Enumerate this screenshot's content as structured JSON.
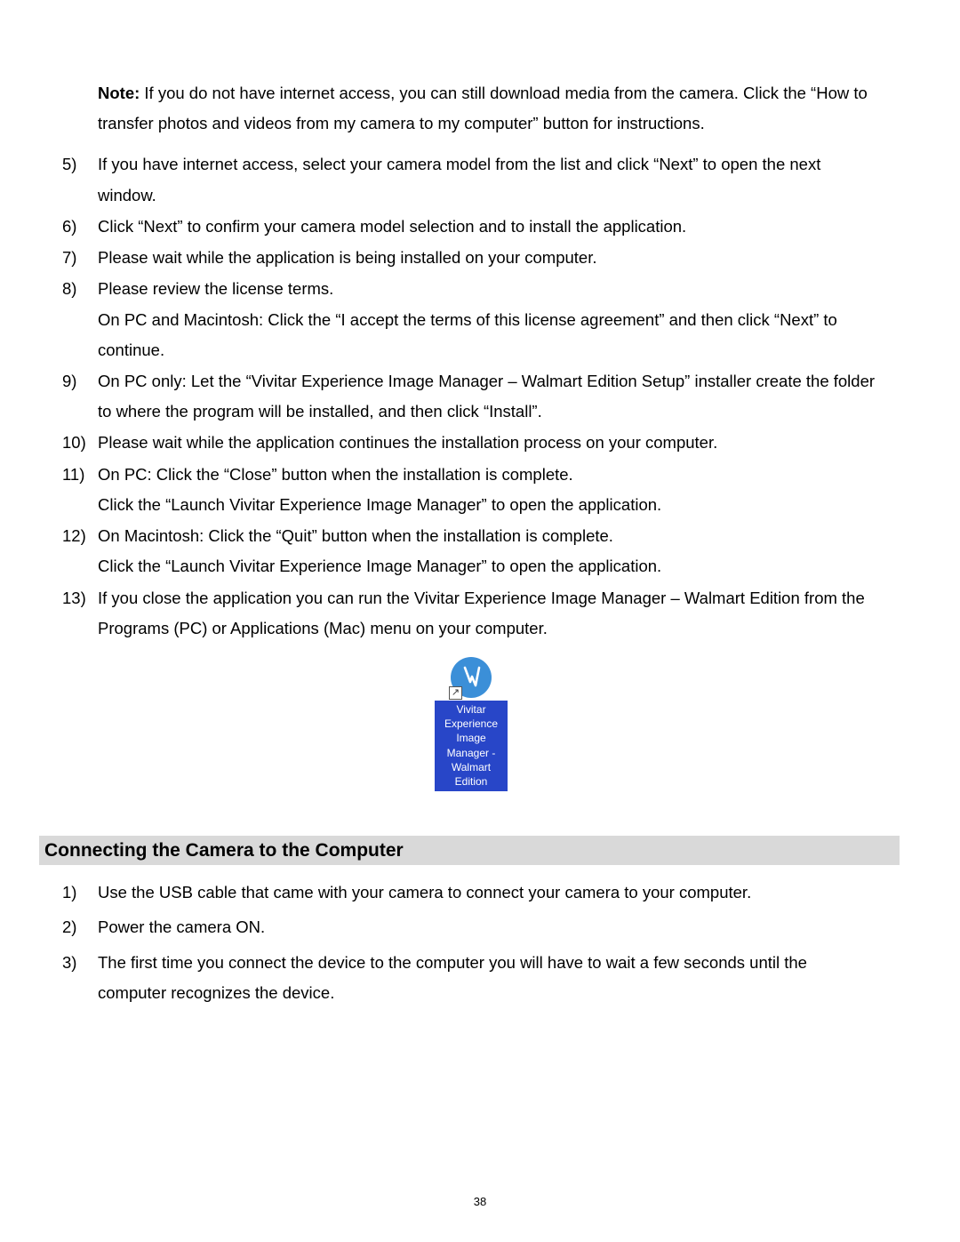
{
  "note_label": "Note:",
  "note_text": " If you do not have internet access, you can still download media from the camera. Click the “How to transfer photos and videos from my camera to my computer” button for instructions.",
  "list": [
    {
      "num": "5)",
      "text": "If you have internet access, select your camera model from the list and click “Next” to open the next window."
    },
    {
      "num": "6)",
      "text": "Click “Next” to confirm your camera model selection and to install the application."
    },
    {
      "num": "7)",
      "text": "Please wait while the application is being installed on your computer."
    },
    {
      "num": "8)",
      "text": "Please review the license terms.\nOn PC and Macintosh: Click the “I accept the terms of this license agreement” and then click “Next” to continue."
    },
    {
      "num": "9)",
      "text": "On PC only: Let the “Vivitar Experience Image Manager – Walmart Edition Setup” installer create the folder to where the program will be installed, and then click “Install”."
    },
    {
      "num": "10)",
      "text": "Please wait while the application continues the installation process on your computer."
    },
    {
      "num": "11)",
      "text": "On PC: Click the “Close” button when the installation is complete.\nClick the “Launch Vivitar Experience Image Manager” to open the application."
    },
    {
      "num": "12)",
      "text": "On Macintosh: Click the “Quit” button when the installation is complete.\nClick the “Launch Vivitar Experience Image Manager” to open the application."
    },
    {
      "num": "13)",
      "text": "If you close the application you can run the Vivitar Experience Image Manager – Walmart Edition from the Programs (PC) or Applications (Mac) menu on your computer."
    }
  ],
  "icon_label": "Vivitar Experience Image Manager - Walmart Edition",
  "section_heading": "Connecting the Camera to the Computer",
  "list2": [
    {
      "num": "1)",
      "text": "Use the USB cable that came with your camera to connect your camera to your computer."
    },
    {
      "num": "2)",
      "text": "Power the camera ON."
    },
    {
      "num": "3)",
      "text": "The first time you connect the device to the computer you will have to wait a few seconds until the computer recognizes the device."
    }
  ],
  "page_number": "38"
}
